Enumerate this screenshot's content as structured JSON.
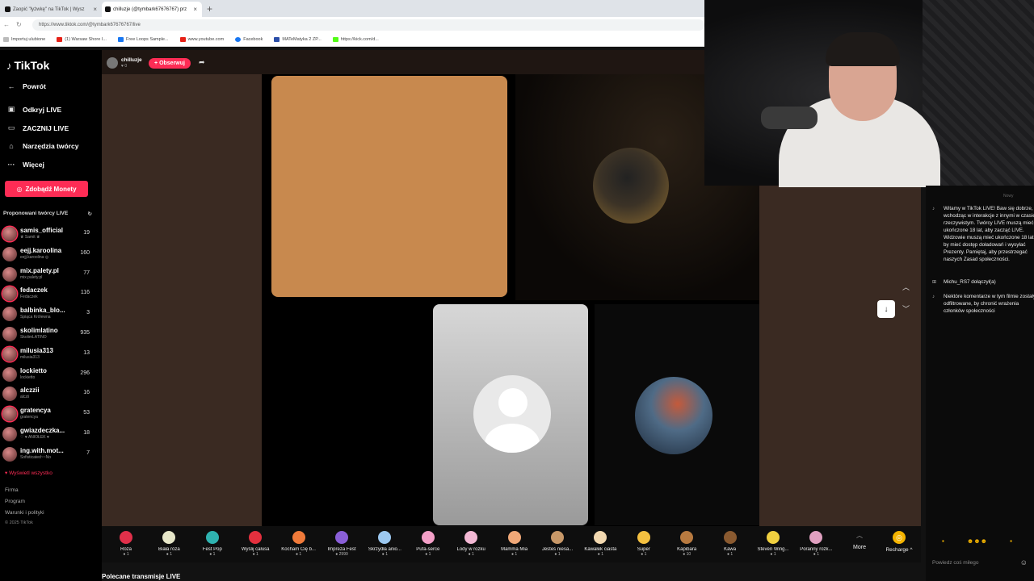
{
  "browser": {
    "tabs": [
      {
        "title": "Zaopić \"łyżwkę\" na TikTok | Wysz"
      },
      {
        "title": "chilluzje (@tymbark67676767) prz"
      }
    ],
    "url": "https://www.tiktok.com/@tymbark67676767/live",
    "bookmarks": [
      "Importuj ulubione",
      "(1) Warsaw Shore I...",
      "Free Loops Sample...",
      "www.youtube.com",
      "Facebook",
      "MATeMatyka 2 ZP...",
      "https://kick.com/d..."
    ]
  },
  "sidebar": {
    "logo": "TikTok",
    "back": "Powrót",
    "nav": [
      "Odkryj LIVE",
      "ZACZNIJ LIVE",
      "Narzędzia twórcy",
      "Więcej"
    ],
    "coins_button": "Zdobądź Monety",
    "suggested_title": "Proponowani twórcy LIVE",
    "creators": [
      {
        "name": "samis_official",
        "sub": "♛ Samit ♛",
        "count": "19"
      },
      {
        "name": "eejj.karoolina",
        "sub": "eejj.karoolina ◎",
        "count": "160"
      },
      {
        "name": "mix.palety.pl",
        "sub": "mix.palety.pl",
        "count": "77"
      },
      {
        "name": "fedaczek",
        "sub": "Fedaczek",
        "count": "116"
      },
      {
        "name": "balbinka_blo...",
        "sub": "Śpiąca Królewna",
        "count": "3"
      },
      {
        "name": "skolimlatino",
        "sub": "SkolimLATINO",
        "count": "935"
      },
      {
        "name": "milusia313",
        "sub": "milusia313",
        "count": "13"
      },
      {
        "name": "lockietto",
        "sub": "lockietto",
        "count": "296"
      },
      {
        "name": "alczzii",
        "sub": "alczii",
        "count": "16"
      },
      {
        "name": "gratencya",
        "sub": "gratencya",
        "count": "53"
      },
      {
        "name": "gwiazdeczka...",
        "sub": "♡ ♥ ANIOŁEK ♥",
        "count": "18"
      },
      {
        "name": "ing.with.mot...",
        "sub": "Sofisticated~~No",
        "count": "7"
      }
    ],
    "see_all": "Wyświetl wszystko",
    "footer": [
      "Firma",
      "Program",
      "Warunki i polityki"
    ],
    "copyright": "© 2025 TikTok"
  },
  "stream": {
    "host_name": "chilluzje",
    "host_sub": "♥ 0",
    "follow": "+ Obserwuj"
  },
  "gifts": [
    {
      "name": "Róża",
      "price": "1",
      "color": "#e0304a"
    },
    {
      "name": "Biała róża",
      "price": "1",
      "color": "#e6e6c8"
    },
    {
      "name": "Fest Pop",
      "price": "1",
      "color": "#2fb3b0"
    },
    {
      "name": "Wyślij całusa",
      "price": "1",
      "color": "#e4303e"
    },
    {
      "name": "Kocham Cię b...",
      "price": "1",
      "color": "#f07a3a"
    },
    {
      "name": "Impreza Fest",
      "price": "2999",
      "color": "#8a5fd8"
    },
    {
      "name": "Skrzydła anio...",
      "price": "1",
      "color": "#9cc8f0"
    },
    {
      "name": "Pufa-serce",
      "price": "1",
      "color": "#f4a0c8"
    },
    {
      "name": "Lody w rożku",
      "price": "1",
      "color": "#f3b8d4"
    },
    {
      "name": "Mamma Mia",
      "price": "1",
      "color": "#f0a878"
    },
    {
      "name": "Jesteś niesa...",
      "price": "1",
      "color": "#c89868"
    },
    {
      "name": "Kawałek ciasta",
      "price": "1",
      "color": "#f2d8b0"
    },
    {
      "name": "Super",
      "price": "1",
      "color": "#f4c040"
    },
    {
      "name": "Kapibara",
      "price": "10",
      "color": "#b87a40"
    },
    {
      "name": "Kawa",
      "price": "1",
      "color": "#8a5a30"
    },
    {
      "name": "Steven Wing...",
      "price": "1",
      "color": "#f0d040"
    },
    {
      "name": "Poranny rozk...",
      "price": "1",
      "color": "#e0a0c0"
    }
  ],
  "gift_bar": {
    "more": "More",
    "recharge": "Recharge ^"
  },
  "recommended_title": "Polecane transmisje LIVE",
  "chat": {
    "messages": [
      {
        "text": "Witamy w TikTok LIVE! Baw się dobrze, wchodząc w interakcje z innymi w czasie rzeczywistym. Twórcy LIVE muszą mieć ukończone 18 lat, aby zacząć LIVE. Widzowie muszą mieć ukończone 18 lat, by mieć dostęp doładowań i wysyłać Prezenty. Pamiętaj, aby przestrzegać naszych Zasad społeczności."
      },
      {
        "text": "Michu_RS7 dołączył(a)"
      },
      {
        "text": "Niektóre komentarze w tym filmie zostały odfiltrowane, by chronić wrażenia członków społeczności"
      }
    ],
    "placeholder": "Powiedz coś miłego"
  }
}
